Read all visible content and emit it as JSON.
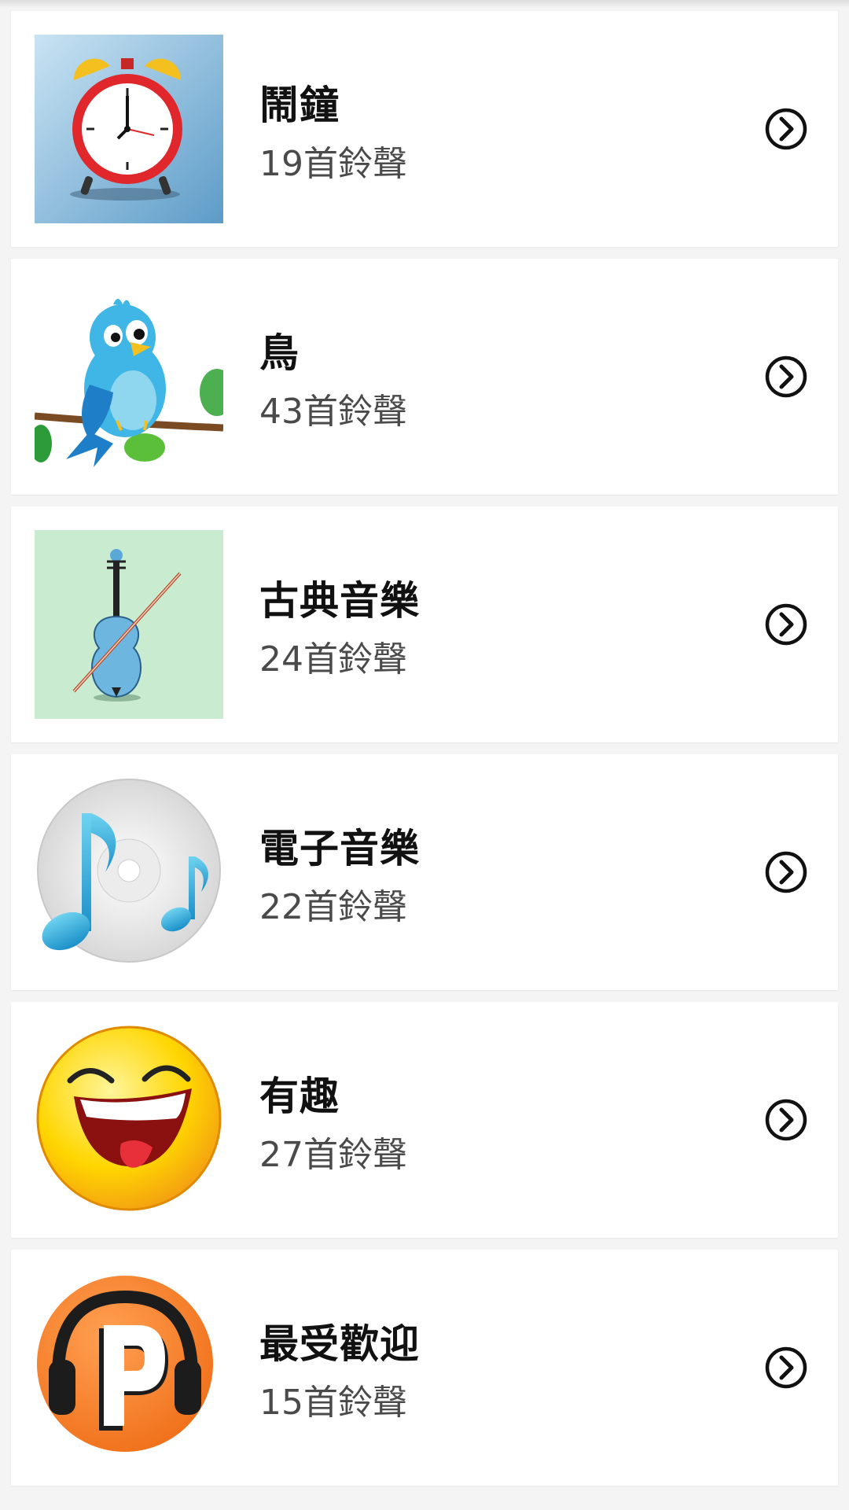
{
  "categories": [
    {
      "title": "鬧鐘",
      "count": "19首鈴聲",
      "icon": "alarm-clock-icon"
    },
    {
      "title": "鳥",
      "count": "43首鈴聲",
      "icon": "bird-icon"
    },
    {
      "title": "古典音樂",
      "count": "24首鈴聲",
      "icon": "violin-icon"
    },
    {
      "title": "電子音樂",
      "count": "22首鈴聲",
      "icon": "music-cd-icon"
    },
    {
      "title": "有趣",
      "count": "27首鈴聲",
      "icon": "laughing-face-icon"
    },
    {
      "title": "最受歡迎",
      "count": "15首鈴聲",
      "icon": "headphones-p-icon"
    }
  ]
}
